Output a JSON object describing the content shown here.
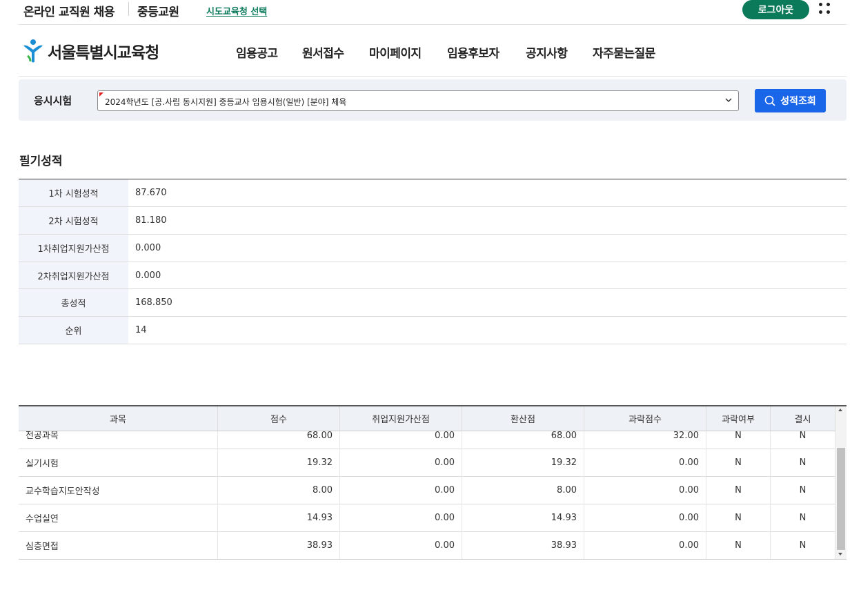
{
  "topbar": {
    "title": "온라인 교직원 채용",
    "subtitle": "중등교원",
    "region_link": "시도교육청 선택",
    "logout": "로그아웃"
  },
  "header": {
    "logo_text": "서울특별시교육청",
    "nav": [
      "임용공고",
      "원서접수",
      "마이페이지",
      "임용후보자",
      "공지사항",
      "자주묻는질문"
    ]
  },
  "search": {
    "label": "응시시험",
    "selected_exam": "2024학년도 [공.사립 동시지원] 중등교사 임용시험(일반) [분야] 체육",
    "button": "성적조회"
  },
  "written": {
    "title": "필기성적",
    "rows": [
      {
        "label": "1차 시험성적",
        "value": "87.670"
      },
      {
        "label": "2차 시험성적",
        "value": "81.180"
      },
      {
        "label": "1차취업지원가산점",
        "value": "0.000"
      },
      {
        "label": "2차취업지원가산점",
        "value": "0.000"
      },
      {
        "label": "총성적",
        "value": "168.850"
      },
      {
        "label": "순위",
        "value": "14"
      }
    ]
  },
  "subjects": {
    "headers": [
      "과목",
      "점수",
      "취업지원가산점",
      "환산점",
      "과락점수",
      "과락여부",
      "결시"
    ],
    "rows": [
      {
        "subject": "전공과목",
        "score": "68.00",
        "bonus": "0.00",
        "converted": "68.00",
        "cutoff": "32.00",
        "failed": "N",
        "absent": "N"
      },
      {
        "subject": "실기시험",
        "score": "19.32",
        "bonus": "0.00",
        "converted": "19.32",
        "cutoff": "0.00",
        "failed": "N",
        "absent": "N"
      },
      {
        "subject": "교수학습지도안작성",
        "score": "8.00",
        "bonus": "0.00",
        "converted": "8.00",
        "cutoff": "0.00",
        "failed": "N",
        "absent": "N"
      },
      {
        "subject": "수업실연",
        "score": "14.93",
        "bonus": "0.00",
        "converted": "14.93",
        "cutoff": "0.00",
        "failed": "N",
        "absent": "N"
      },
      {
        "subject": "심층면접",
        "score": "38.93",
        "bonus": "0.00",
        "converted": "38.93",
        "cutoff": "0.00",
        "failed": "N",
        "absent": "N"
      }
    ]
  },
  "colors": {
    "brand_green": "#0b7a5a",
    "primary_blue": "#1a66e8",
    "panel_bg": "#eef1f6"
  },
  "icons": [
    "grid-menu-icon",
    "seoul-logo-icon",
    "chevron-down-icon",
    "search-icon"
  ]
}
